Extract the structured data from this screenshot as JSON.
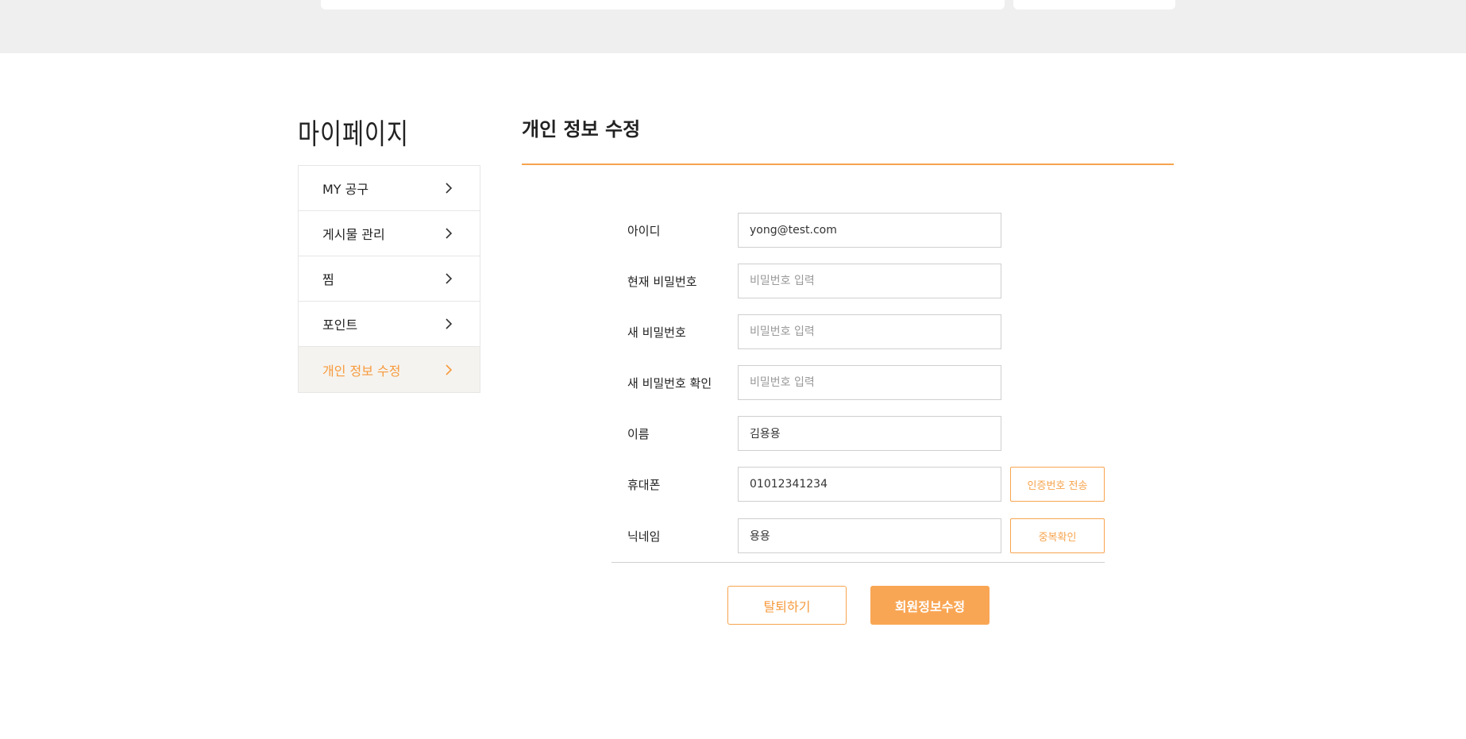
{
  "mypage": {
    "title": "마이페이지"
  },
  "sidebar": {
    "items": [
      {
        "label": "MY 공구",
        "icon": "chevron-right-icon",
        "active": false
      },
      {
        "label": "게시물 관리",
        "icon": "chevron-right-icon",
        "active": false
      },
      {
        "label": "찜",
        "icon": "chevron-right-icon",
        "active": false
      },
      {
        "label": "포인트",
        "icon": "chevron-right-icon",
        "active": false
      },
      {
        "label": "개인 정보 수정",
        "icon": "chevron-right-icon",
        "active": true
      }
    ]
  },
  "section": {
    "title": "개인 정보 수정"
  },
  "form": {
    "id": {
      "label": "아이디",
      "value": "yong@test.com"
    },
    "current_password": {
      "label": "현재 비밀번호",
      "placeholder": "비밀번호 입력"
    },
    "new_password": {
      "label": "새 비밀번호",
      "placeholder": "비밀번호 입력"
    },
    "new_password_confirm": {
      "label": "새 비밀번호 확인",
      "placeholder": "비밀번호 입력"
    },
    "name": {
      "label": "이름",
      "value": "김용용"
    },
    "phone": {
      "label": "휴대폰",
      "value": "01012341234",
      "button": "인증번호 전송"
    },
    "nickname": {
      "label": "닉네임",
      "value": "용용",
      "button": "중복확인"
    }
  },
  "actions": {
    "withdraw": "탈퇴하기",
    "submit": "회원정보수정"
  },
  "colors": {
    "accent": "#f7a44e",
    "accent_fill": "#f9a654",
    "active_bg": "#f5f3ef",
    "band_bg": "#efefef"
  }
}
